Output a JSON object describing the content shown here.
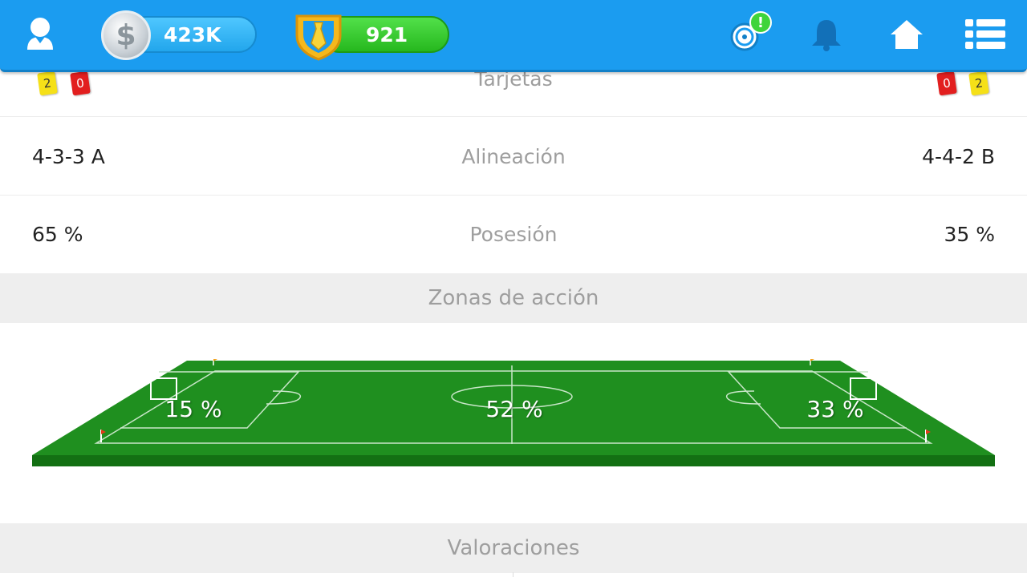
{
  "topbar": {
    "money": "423K",
    "gems": "921",
    "notification_badge": "!",
    "accent_color": "#1b9cf0"
  },
  "cards": {
    "home_yellow": "2",
    "home_red": "0",
    "away_red": "0",
    "away_yellow": "2",
    "label": "Tarjetas"
  },
  "stats": [
    {
      "home": "4-3-3 A",
      "label": "Alineación",
      "away": "4-4-2 B"
    },
    {
      "home": "65 %",
      "label": "Posesión",
      "away": "35 %"
    }
  ],
  "zones": {
    "title": "Zonas de acción",
    "left": "15 %",
    "center": "52 %",
    "right": "33 %"
  },
  "ratings": {
    "title": "Valoraciones"
  }
}
